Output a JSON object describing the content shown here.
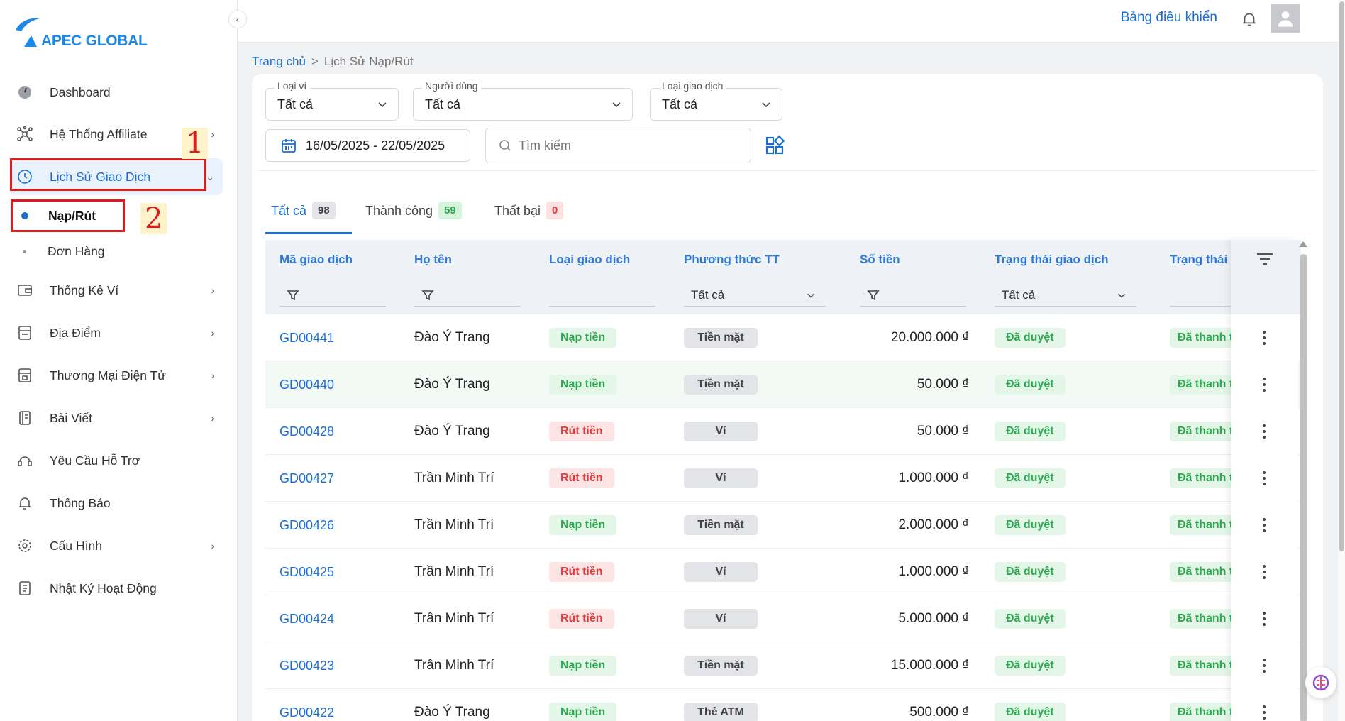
{
  "brand": {
    "name": "APEC GLOBAL",
    "color": "#1e88e5"
  },
  "header": {
    "dashboard_link": "Bảng điều khiển",
    "bell_icon": "bell-icon",
    "avatar_icon": "user-icon"
  },
  "breadcrumb": {
    "home": "Trang chủ",
    "separator": ">",
    "current": "Lịch Sử Nạp/Rút"
  },
  "sidebar": {
    "items": [
      {
        "label": "Dashboard",
        "icon": "gauge-icon"
      },
      {
        "label": "Hệ Thống Affiliate",
        "icon": "network-icon"
      },
      {
        "label": "Lịch Sử Giao Dịch",
        "icon": "clock-icon"
      },
      {
        "label": "Thống Kê Ví",
        "icon": "wallet-icon"
      },
      {
        "label": "Địa Điểm",
        "icon": "store-icon"
      },
      {
        "label": "Thương Mại Điện Tử",
        "icon": "shop-icon"
      },
      {
        "label": "Bài Viết",
        "icon": "notebook-icon"
      },
      {
        "label": "Yêu Cầu Hỗ Trợ",
        "icon": "support-icon"
      },
      {
        "label": "Thông Báo",
        "icon": "bell-icon"
      },
      {
        "label": "Cấu Hình",
        "icon": "gear-icon"
      },
      {
        "label": "Nhật Ký Hoạt Động",
        "icon": "log-icon"
      }
    ],
    "sub_items": [
      {
        "label": "Nạp/Rút"
      },
      {
        "label": "Đơn Hàng"
      }
    ]
  },
  "annotations": {
    "one": "1",
    "two": "2"
  },
  "filters": {
    "wallet": {
      "label": "Loại ví",
      "value": "Tất cả"
    },
    "user": {
      "label": "Người dùng",
      "value": "Tất cả"
    },
    "type": {
      "label": "Loại giao dịch",
      "value": "Tất cả"
    },
    "date_range": "16/05/2025 - 22/05/2025",
    "search_placeholder": "Tìm kiếm"
  },
  "tabs": [
    {
      "label": "Tất cả",
      "count": "98"
    },
    {
      "label": "Thành công",
      "count": "59"
    },
    {
      "label": "Thất bại",
      "count": "0"
    }
  ],
  "table": {
    "columns": [
      "Mã giao dịch",
      "Họ tên",
      "Loại giao dịch",
      "Phương thức TT",
      "Số tiền",
      "Trạng thái giao dịch",
      "Trạng thái"
    ],
    "method_filter": "Tất cả",
    "status_filter": "Tất cả",
    "rows": [
      {
        "code": "GD00441",
        "name": "Đào Ý Trang",
        "type": "Nạp tiền",
        "method": "Tiền mặt",
        "amount": "20.000.000 ₫",
        "status": "Đã duyệt",
        "pay": "Đã thanh t"
      },
      {
        "code": "GD00440",
        "name": "Đào Ý Trang",
        "type": "Nạp tiền",
        "method": "Tiền mặt",
        "amount": "50.000 ₫",
        "status": "Đã duyệt",
        "pay": "Đã thanh t"
      },
      {
        "code": "GD00428",
        "name": "Đào Ý Trang",
        "type": "Rút tiền",
        "method": "Ví",
        "amount": "50.000 ₫",
        "status": "Đã duyệt",
        "pay": "Đã thanh t"
      },
      {
        "code": "GD00427",
        "name": "Trần Minh Trí",
        "type": "Rút tiền",
        "method": "Ví",
        "amount": "1.000.000 ₫",
        "status": "Đã duyệt",
        "pay": "Đã thanh t"
      },
      {
        "code": "GD00426",
        "name": "Trần Minh Trí",
        "type": "Nạp tiền",
        "method": "Tiền mặt",
        "amount": "2.000.000 ₫",
        "status": "Đã duyệt",
        "pay": "Đã thanh t"
      },
      {
        "code": "GD00425",
        "name": "Trần Minh Trí",
        "type": "Rút tiền",
        "method": "Ví",
        "amount": "1.000.000 ₫",
        "status": "Đã duyệt",
        "pay": "Đã thanh t"
      },
      {
        "code": "GD00424",
        "name": "Trần Minh Trí",
        "type": "Rút tiền",
        "method": "Ví",
        "amount": "5.000.000 ₫",
        "status": "Đã duyệt",
        "pay": "Đã thanh t"
      },
      {
        "code": "GD00423",
        "name": "Trần Minh Trí",
        "type": "Nạp tiền",
        "method": "Tiền mặt",
        "amount": "15.000.000 ₫",
        "status": "Đã duyệt",
        "pay": "Đã thanh t"
      },
      {
        "code": "GD00422",
        "name": "Đào Ý Trang",
        "type": "Nạp tiền",
        "method": "Thẻ ATM",
        "amount": "500.000 ₫",
        "status": "Đã duyệt",
        "pay": "Đã thanh t"
      }
    ]
  },
  "colors": {
    "accent": "#1a6fd6",
    "success": "#2ea851",
    "danger": "#e23b3b",
    "annotation": "#e01b1b"
  }
}
